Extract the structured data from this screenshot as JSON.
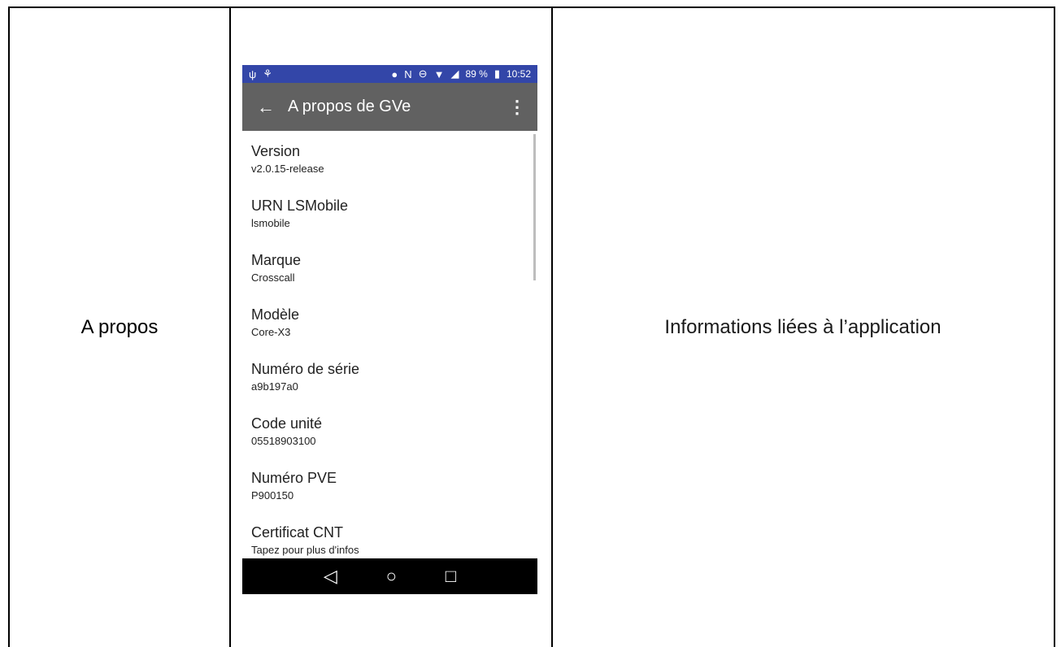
{
  "row_label": "A propos",
  "description": "Informations liées à l’application",
  "phone": {
    "status": {
      "left_icons": [
        "usb-icon",
        "sync-icon"
      ],
      "right_icons": [
        "location-icon",
        "nfc-icon",
        "do-not-disturb-icon",
        "wifi-icon",
        "signal-icon"
      ],
      "battery": "89 %",
      "time": "10:52"
    },
    "appbar": {
      "back_icon": "arrow-back-icon",
      "title": "A propos de GVe",
      "menu_icon": "more-vert-icon"
    },
    "items": [
      {
        "label": "Version",
        "value": "v2.0.15-release"
      },
      {
        "label": "URN LSMobile",
        "value": "lsmobile"
      },
      {
        "label": "Marque",
        "value": "Crosscall"
      },
      {
        "label": "Modèle",
        "value": "Core-X3"
      },
      {
        "label": "Numéro de série",
        "value": "a9b197a0"
      },
      {
        "label": "Code unité",
        "value": "05518903100"
      },
      {
        "label": "Numéro PVE",
        "value": "P900150"
      },
      {
        "label": "Certificat CNT",
        "value": "Tapez pour plus d'infos"
      }
    ],
    "navbar": {
      "back": "back-triangle-icon",
      "home": "home-circle-icon",
      "recents": "recents-square-icon"
    }
  },
  "colors": {
    "status_bar": "#3346a8",
    "app_bar": "#616161",
    "nav_bar": "#000000"
  }
}
